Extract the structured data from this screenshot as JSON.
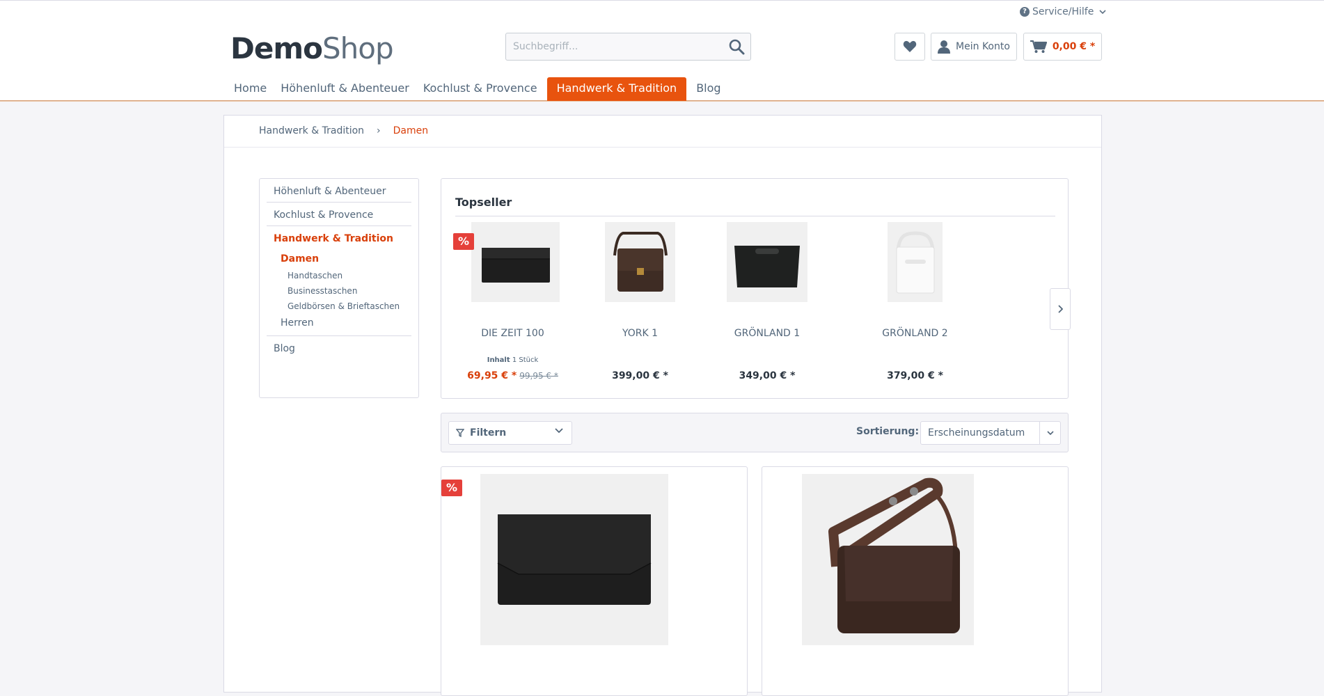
{
  "header": {
    "service_label": "Service/Hilfe",
    "logo": {
      "bold": "Demo",
      "light": "Shop"
    },
    "search_placeholder": "Suchbegriff...",
    "account_label": "Mein Konto",
    "cart_amount": "0,00 € *"
  },
  "nav": {
    "items": [
      {
        "label": "Home"
      },
      {
        "label": "Höhenluft & Abenteuer"
      },
      {
        "label": "Kochlust & Provence"
      },
      {
        "label": "Handwerk & Tradition"
      },
      {
        "label": "Blog"
      }
    ]
  },
  "breadcrumb": {
    "items": [
      {
        "label": "Handwerk & Tradition"
      },
      {
        "label": "Damen"
      }
    ],
    "separator": "›"
  },
  "sidebar": {
    "items": [
      {
        "label": "Höhenluft & Abenteuer"
      },
      {
        "label": "Kochlust & Provence"
      },
      {
        "label": "Handwerk & Tradition"
      },
      {
        "label": "Damen"
      },
      {
        "label": "Handtaschen"
      },
      {
        "label": "Businesstaschen"
      },
      {
        "label": "Geldbörsen & Brieftaschen"
      },
      {
        "label": "Herren"
      },
      {
        "label": "Blog"
      }
    ]
  },
  "topseller": {
    "title": "Topseller",
    "badge": "%",
    "products": [
      {
        "name": "DIE ZEIT 100",
        "inhalt_label": "Inhalt",
        "inhalt_value": "1 Stück",
        "price": "69,95 € *",
        "old_price": "99,95 € *"
      },
      {
        "name": "YORK 1",
        "price": "399,00 € *"
      },
      {
        "name": "GRÖNLAND 1",
        "price": "349,00 € *"
      },
      {
        "name": "GRÖNLAND 2",
        "price": "379,00 € *"
      }
    ]
  },
  "filterbar": {
    "filter_label": "Filtern",
    "sort_label": "Sortierung:",
    "sort_value": "Erscheinungsdatum"
  },
  "listing": {
    "badge": "%"
  },
  "colors": {
    "accent": "#e8530e",
    "sale": "#d9400b",
    "badge": "#e5403a",
    "highlight": "#2a7ae9"
  }
}
